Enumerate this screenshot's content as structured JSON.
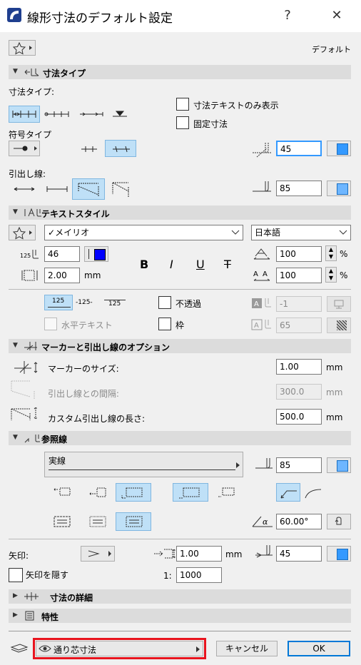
{
  "window": {
    "title": "線形寸法のデフォルト設定",
    "help": "?",
    "close": "✕"
  },
  "header": {
    "default_label": "デフォルト"
  },
  "dim_type": {
    "section": "寸法タイプ",
    "type_label": "寸法タイプ:",
    "symbol_label": "符号タイプ",
    "witness_label": "引出し線:",
    "text_only": "寸法テキストのみ表示",
    "fixed": "固定寸法",
    "angle_value": "45",
    "witness_value": "85"
  },
  "text_style": {
    "section": "テキストスタイル",
    "font": "メイリオ",
    "language": "日本語",
    "size": "46",
    "gap": "2.00",
    "gap_unit": "mm",
    "bold": "B",
    "italic": "I",
    "underline": "U",
    "strike": "T",
    "width_pct": "100",
    "spacing_pct": "100",
    "pct": "%",
    "sample_a": "125",
    "sample_b": "-125-",
    "sample_c": "125",
    "opaque": "不透過",
    "horizontal": "水平テキスト",
    "frame": "枠",
    "pen_a": "-1",
    "pen_b": "65"
  },
  "markers": {
    "section": "マーカーと引出し線のオプション",
    "marker_size_label": "マーカーのサイズ:",
    "marker_size": "1.00",
    "gap_label": "引出し線との間隔:",
    "gap": "300.0",
    "custom_len_label": "カスタム引出し線の長さ:",
    "custom_len": "500.0",
    "unit": "mm"
  },
  "ref_line": {
    "section": "参照線",
    "line_type": "実線",
    "pen": "85",
    "angle": "60.00°"
  },
  "arrow": {
    "label": "矢印:",
    "size": "1.00",
    "unit": "mm",
    "pen": "45",
    "hide": "矢印を隠す",
    "scale_label": "1:",
    "scale": "1000"
  },
  "collapsed": {
    "details": "寸法の詳細",
    "props": "特性"
  },
  "footer": {
    "filter": "通り芯寸法",
    "cancel": "キャンセル",
    "ok": "OK"
  },
  "colors": {
    "accent": "#3399ff",
    "selected_bg": "#bfe0f7",
    "highlight_border": "#e8141e",
    "font_color": "#0000ff"
  }
}
